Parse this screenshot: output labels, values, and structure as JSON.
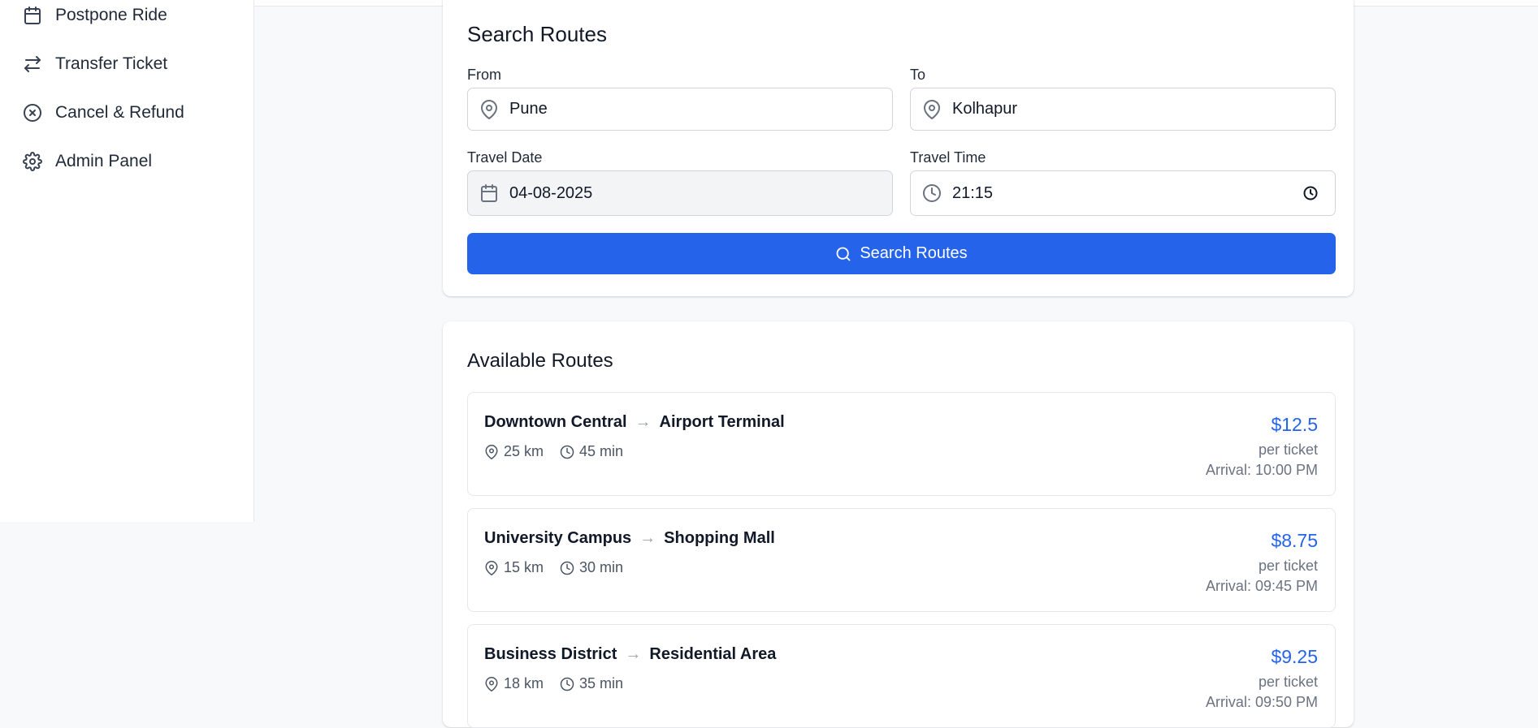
{
  "sidebar": {
    "items": [
      {
        "label": "Postpone Ride",
        "icon": "calendar-icon"
      },
      {
        "label": "Transfer Ticket",
        "icon": "transfer-icon"
      },
      {
        "label": "Cancel & Refund",
        "icon": "cancel-circle-icon"
      },
      {
        "label": "Admin Panel",
        "icon": "gear-icon"
      }
    ]
  },
  "search": {
    "title": "Search Routes",
    "from_label": "From",
    "from_value": "Pune",
    "to_label": "To",
    "to_value": "Kolhapur",
    "date_label": "Travel Date",
    "date_value": "04-08-2025",
    "time_label": "Travel Time",
    "time_value": "21:15",
    "button_label": "Search Routes"
  },
  "routes": {
    "title": "Available Routes",
    "items": [
      {
        "from": "Downtown Central",
        "to": "Airport Terminal",
        "distance": "25 km",
        "duration": "45 min",
        "price": "$12.5",
        "per": "per ticket",
        "arrival": "Arrival: 10:00 PM"
      },
      {
        "from": "University Campus",
        "to": "Shopping Mall",
        "distance": "15 km",
        "duration": "30 min",
        "price": "$8.75",
        "per": "per ticket",
        "arrival": "Arrival: 09:45 PM"
      },
      {
        "from": "Business District",
        "to": "Residential Area",
        "distance": "18 km",
        "duration": "35 min",
        "price": "$9.25",
        "per": "per ticket",
        "arrival": "Arrival: 09:50 PM"
      }
    ],
    "arrow": "→"
  },
  "colors": {
    "accent": "#2563eb",
    "background": "#f8f9fb",
    "border": "#e5e7eb"
  }
}
